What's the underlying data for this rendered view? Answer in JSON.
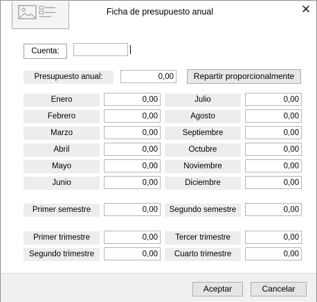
{
  "window": {
    "title": "Ficha de presupuesto anual",
    "close_glyph": "✕"
  },
  "cuenta": {
    "label": "Cuenta:",
    "value": ""
  },
  "presupuesto": {
    "label": "Presupuesto anual:",
    "value": "0,00"
  },
  "repartir_label": "Repartir proporcionalmente",
  "months_left": [
    {
      "label": "Enero",
      "value": "0,00"
    },
    {
      "label": "Febrero",
      "value": "0,00"
    },
    {
      "label": "Marzo",
      "value": "0,00"
    },
    {
      "label": "Abril",
      "value": "0,00"
    },
    {
      "label": "Mayo",
      "value": "0,00"
    },
    {
      "label": "Junio",
      "value": "0,00"
    }
  ],
  "months_right": [
    {
      "label": "Julio",
      "value": "0,00"
    },
    {
      "label": "Agosto",
      "value": "0,00"
    },
    {
      "label": "Septiembre",
      "value": "0,00"
    },
    {
      "label": "Octubre",
      "value": "0,00"
    },
    {
      "label": "Noviembre",
      "value": "0,00"
    },
    {
      "label": "Diciembre",
      "value": "0,00"
    }
  ],
  "semesters": [
    {
      "label": "Primer semestre",
      "value": "0,00"
    },
    {
      "label": "Segundo semestre",
      "value": "0,00"
    }
  ],
  "trimesters": [
    {
      "label": "Primer trimestre",
      "value": "0,00"
    },
    {
      "label": "Tercer trimestre",
      "value": "0,00"
    },
    {
      "label": "Segundo trimestre",
      "value": "0,00"
    },
    {
      "label": "Cuarto trimestre",
      "value": "0,00"
    }
  ],
  "footer": {
    "accept_label": "Aceptar",
    "cancel_label": "Cancelar"
  },
  "icons": {
    "logo": "image-placeholder-icon",
    "close": "close-icon"
  }
}
